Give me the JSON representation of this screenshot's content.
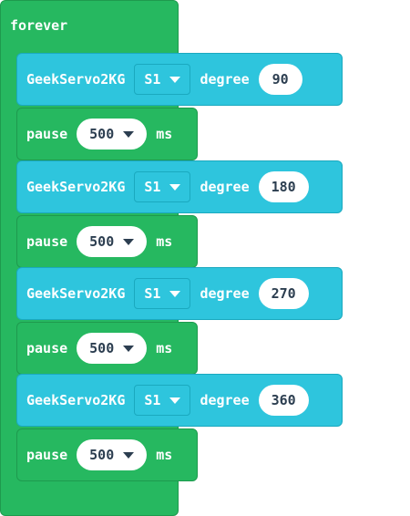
{
  "forever": {
    "label": "forever"
  },
  "blocks": [
    {
      "type": "servo",
      "name": "GeekServo2KG",
      "port": "S1",
      "degree_label": "degree",
      "degree": "90"
    },
    {
      "type": "pause",
      "label": "pause",
      "value": "500",
      "unit": "ms"
    },
    {
      "type": "servo",
      "name": "GeekServo2KG",
      "port": "S1",
      "degree_label": "degree",
      "degree": "180"
    },
    {
      "type": "pause",
      "label": "pause",
      "value": "500",
      "unit": "ms"
    },
    {
      "type": "servo",
      "name": "GeekServo2KG",
      "port": "S1",
      "degree_label": "degree",
      "degree": "270"
    },
    {
      "type": "pause",
      "label": "pause",
      "value": "500",
      "unit": "ms"
    },
    {
      "type": "servo",
      "name": "GeekServo2KG",
      "port": "S1",
      "degree_label": "degree",
      "degree": "360"
    },
    {
      "type": "pause",
      "label": "pause",
      "value": "500",
      "unit": "ms"
    }
  ]
}
